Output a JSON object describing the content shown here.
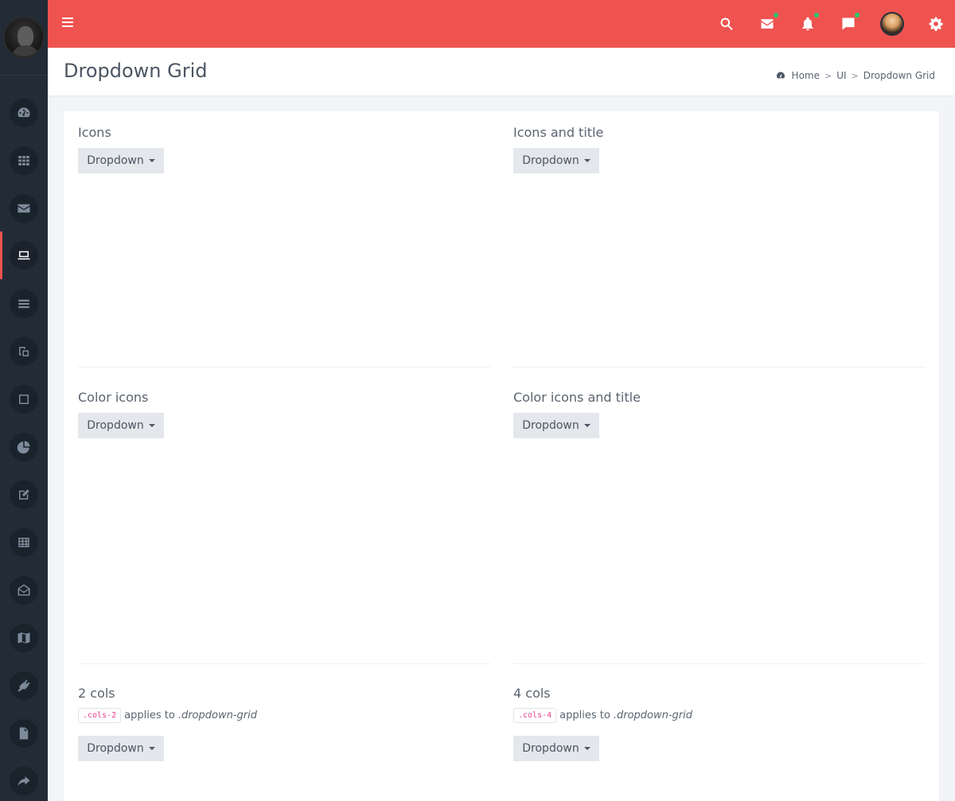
{
  "sidebar": {
    "items": [
      {
        "name": "dashboard-icon"
      },
      {
        "name": "apps-grid-icon"
      },
      {
        "name": "mail-icon"
      },
      {
        "name": "laptop-icon",
        "active": true
      },
      {
        "name": "list-icon"
      },
      {
        "name": "copy-icon"
      },
      {
        "name": "square-icon"
      },
      {
        "name": "pie-chart-icon"
      },
      {
        "name": "edit-icon"
      },
      {
        "name": "table-icon"
      },
      {
        "name": "envelope-open-icon"
      },
      {
        "name": "map-icon"
      },
      {
        "name": "plug-icon"
      },
      {
        "name": "file-icon"
      },
      {
        "name": "share-icon"
      }
    ]
  },
  "topbar": {
    "accent_color": "#ef5350",
    "icons": [
      "search-icon",
      "mail-icon",
      "bell-icon",
      "chat-icon",
      "user-avatar",
      "gear-icon"
    ]
  },
  "header": {
    "title": "Dropdown Grid",
    "breadcrumb": [
      "Home",
      "UI",
      "Dropdown Grid"
    ]
  },
  "sections": [
    {
      "title": "Icons",
      "button": "Dropdown"
    },
    {
      "title": "Icons and title",
      "button": "Dropdown"
    },
    {
      "title": "Color icons",
      "button": "Dropdown"
    },
    {
      "title": "Color icons and title",
      "button": "Dropdown"
    },
    {
      "title": "2 cols",
      "code": ".cols-2",
      "desc": "applies to",
      "target": ".dropdown-grid",
      "button": "Dropdown"
    },
    {
      "title": "4 cols",
      "code": ".cols-4",
      "desc": "applies to",
      "target": ".dropdown-grid",
      "button": "Dropdown"
    }
  ]
}
